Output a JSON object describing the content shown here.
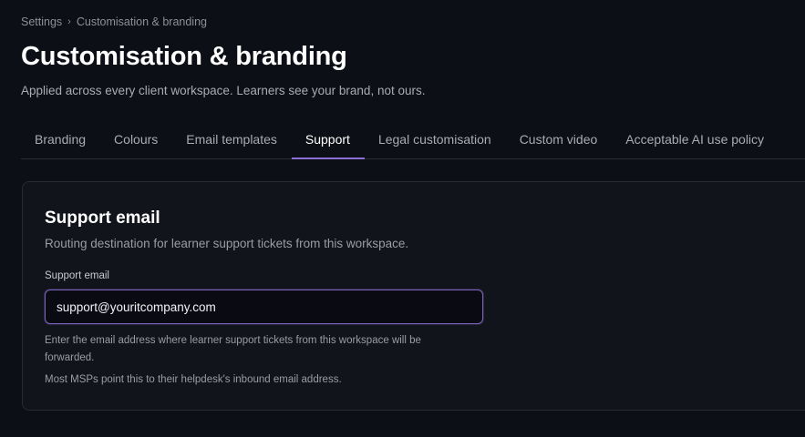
{
  "breadcrumb": {
    "items": [
      "Settings",
      "Customisation & branding"
    ],
    "separator": "›"
  },
  "header": {
    "title": "Customisation & branding",
    "subtitle": "Applied across every client workspace. Learners see your brand, not ours."
  },
  "tabs": [
    {
      "label": "Branding",
      "active": false
    },
    {
      "label": "Colours",
      "active": false
    },
    {
      "label": "Email templates",
      "active": false
    },
    {
      "label": "Support",
      "active": true
    },
    {
      "label": "Legal customisation",
      "active": false
    },
    {
      "label": "Custom video",
      "active": false
    },
    {
      "label": "Acceptable AI use policy",
      "active": false
    }
  ],
  "support_card": {
    "title": "Support email",
    "description": "Routing destination for learner support tickets from this workspace.",
    "field_label": "Support email",
    "field_value": "support@youritcompany.com",
    "help_text_1": "Enter the email address where learner support tickets from this workspace will be forwarded.",
    "help_text_2": "Most MSPs point this to their helpdesk's inbound email address."
  },
  "colors": {
    "background": "#0d0f17",
    "card": "#12141c",
    "accent": "#8b6fd6"
  }
}
